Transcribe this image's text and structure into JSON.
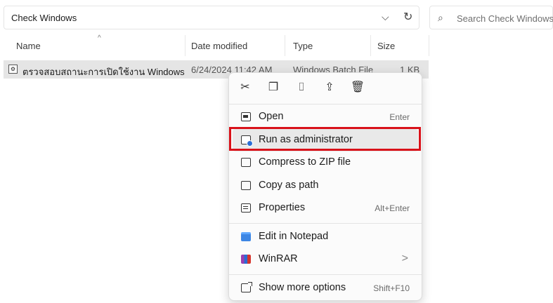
{
  "address": {
    "path": "Check Windows",
    "chevron_glyph": "⌵",
    "refresh_glyph": "↻"
  },
  "search": {
    "placeholder": "Search Check Windows",
    "icon": "search-icon"
  },
  "columns": {
    "name": "Name",
    "date": "Date modified",
    "type": "Type",
    "size": "Size",
    "sort_glyph": "^"
  },
  "file": {
    "name": "ตรวจสอบสถานะการเปิดใช้งาน Windows",
    "date": "6/24/2024 11:42 AM",
    "type": "Windows Batch File",
    "size": "1 KB"
  },
  "quick_actions": [
    {
      "name": "cut",
      "glyph": "✂"
    },
    {
      "name": "copy",
      "glyph": "❐"
    },
    {
      "name": "rename",
      "glyph": "⌷"
    },
    {
      "name": "share",
      "glyph": "⇪"
    },
    {
      "name": "delete",
      "glyph": "🗑"
    }
  ],
  "menu": {
    "open": {
      "label": "Open",
      "shortcut": "Enter"
    },
    "run_admin": {
      "label": "Run as administrator"
    },
    "compress": {
      "label": "Compress to ZIP file"
    },
    "copy_path": {
      "label": "Copy as path"
    },
    "properties": {
      "label": "Properties",
      "shortcut": "Alt+Enter"
    },
    "edit_notepad": {
      "label": "Edit in Notepad"
    },
    "winrar": {
      "label": "WinRAR",
      "chevron": ">"
    },
    "more": {
      "label": "Show more options",
      "shortcut": "Shift+F10"
    }
  },
  "highlight_color": "#d9121a"
}
